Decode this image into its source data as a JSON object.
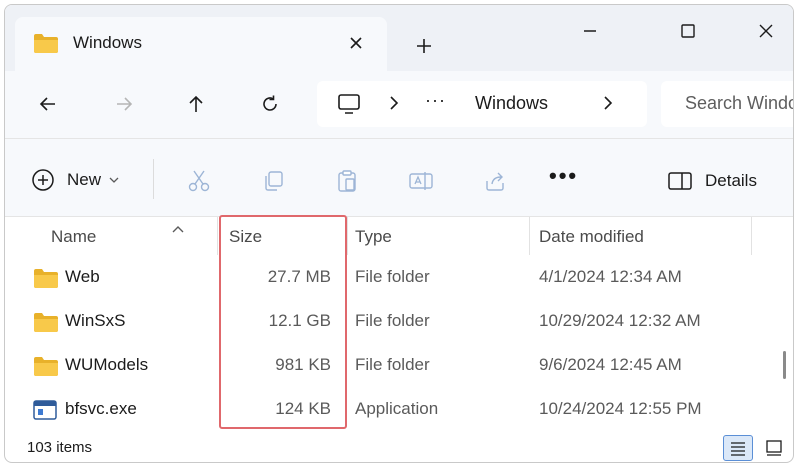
{
  "tab": {
    "title": "Windows"
  },
  "address": {
    "overflow": "···",
    "crumb": "Windows"
  },
  "search": {
    "placeholder": "Search Windows"
  },
  "commandbar": {
    "new_label": "New",
    "more_label": "•••",
    "details_label": "Details"
  },
  "columns": {
    "name": "Name",
    "size": "Size",
    "type": "Type",
    "date": "Date modified"
  },
  "rows": [
    {
      "name": "Web",
      "size": "27.7 MB",
      "type": "File folder",
      "date": "4/1/2024 12:34 AM",
      "icon": "folder-icon"
    },
    {
      "name": "WinSxS",
      "size": "12.1 GB",
      "type": "File folder",
      "date": "10/29/2024 12:32 AM",
      "icon": "folder-icon"
    },
    {
      "name": "WUModels",
      "size": "981 KB",
      "type": "File folder",
      "date": "9/6/2024 12:45 AM",
      "icon": "folder-icon"
    },
    {
      "name": "bfsvc.exe",
      "size": "124 KB",
      "type": "Application",
      "date": "10/24/2024 12:55 PM",
      "icon": "application-icon"
    }
  ],
  "status": {
    "item_count": "103 items"
  },
  "colors": {
    "folder": "#f5c542",
    "highlight": "#e0686c",
    "accent": "#5b8fd6"
  }
}
